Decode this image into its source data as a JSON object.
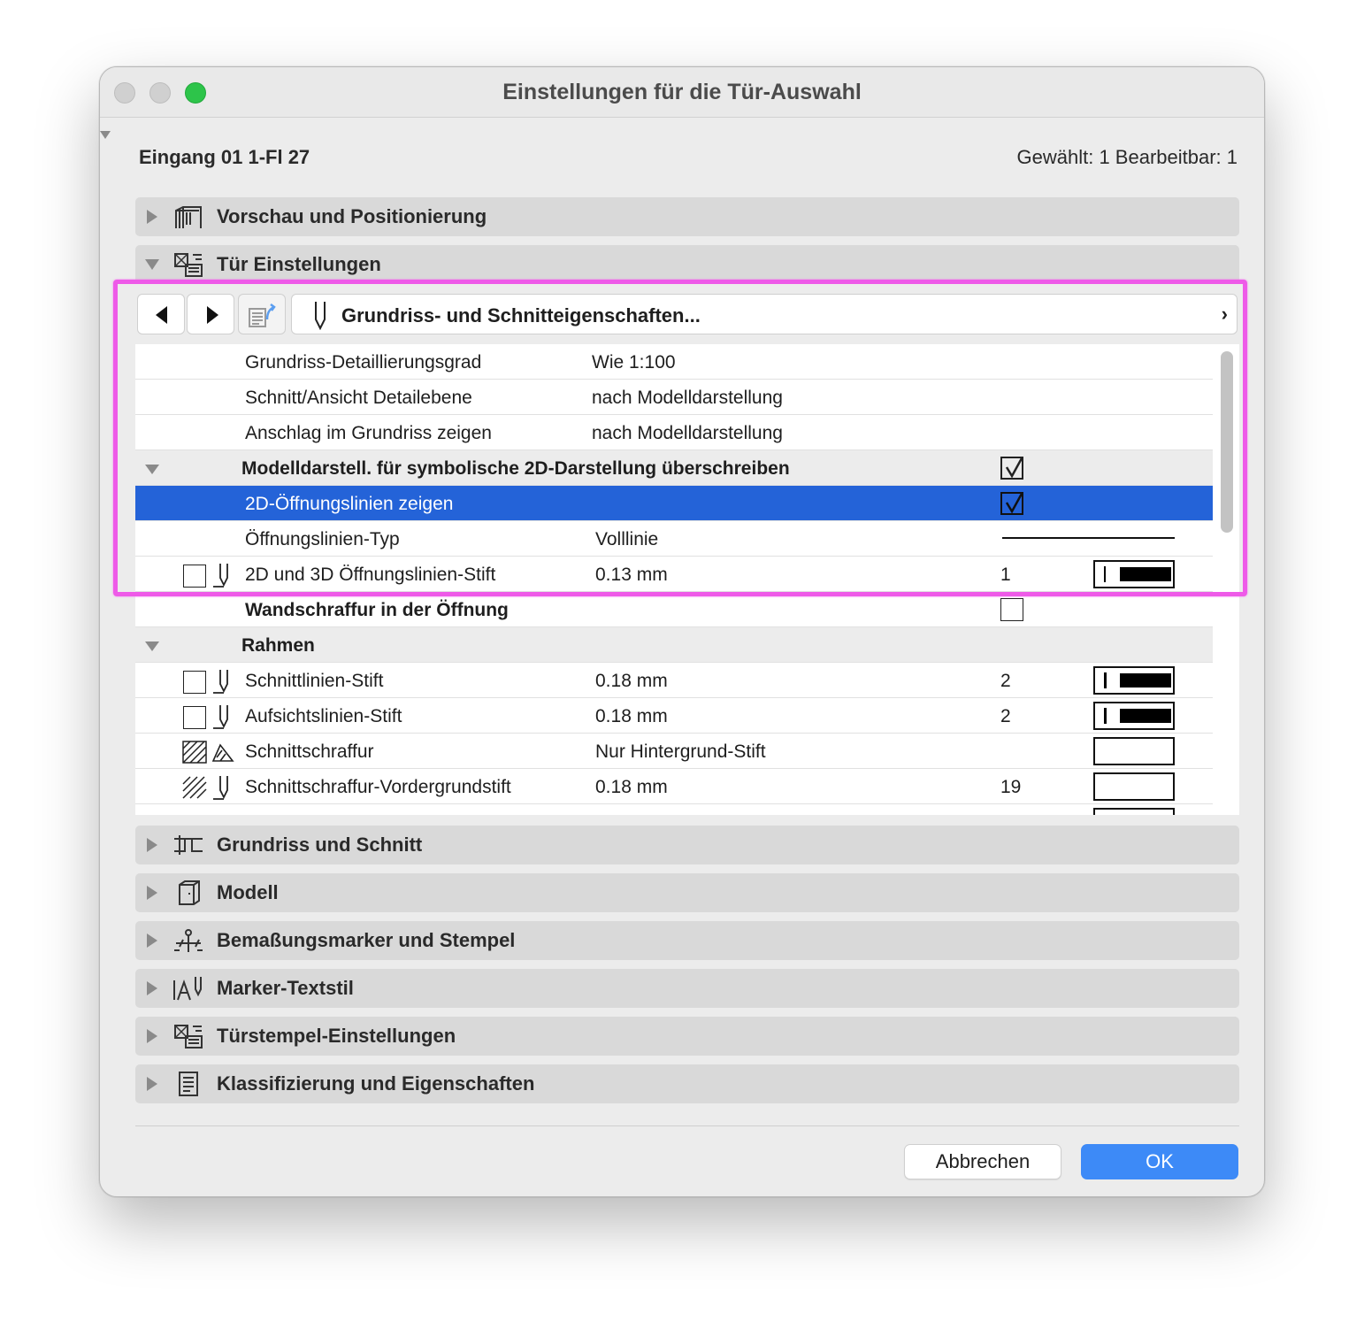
{
  "window": {
    "title": "Einstellungen für die Tür-Auswahl"
  },
  "header": {
    "element_name": "Eingang 01 1-Fl 27",
    "selection_info": "Gewählt: 1 Bearbeitbar: 1"
  },
  "panels_top": [
    {
      "label": "Vorschau und Positionierung",
      "expanded": false,
      "icon": "preview-door-icon"
    },
    {
      "label": "Tür Einstellungen",
      "expanded": true,
      "icon": "door-settings-icon"
    }
  ],
  "toolbar": {
    "page_label": "Grundriss- und Schnitteigenschaften...",
    "page_chevron": "›"
  },
  "rows": [
    {
      "label": "Grundriss-Detaillierungsgrad",
      "value": "Wie 1:100"
    },
    {
      "label": "Schnitt/Ansicht Detailebene",
      "value": "nach Modelldarstellung"
    },
    {
      "label": "Anschlag im Grundriss zeigen",
      "value": "nach Modelldarstellung"
    },
    {
      "label": "Modelldarstell. für symbolische 2D-Darstellung überschreiben",
      "group": true,
      "checked": true
    },
    {
      "label": "2D-Öffnungslinien zeigen",
      "selected": true,
      "checked": true
    },
    {
      "label": "Öffnungslinien-Typ",
      "value": "Volllinie"
    },
    {
      "label": "2D und 3D Öffnungslinien-Stift",
      "value": "0.13 mm",
      "num": "1"
    },
    {
      "label": "Wandschraffur in der Öffnung",
      "checked": false
    },
    {
      "label": "Rahmen",
      "group": true
    },
    {
      "label": "Schnittlinien-Stift",
      "value": "0.18 mm",
      "num": "2"
    },
    {
      "label": "Aufsichtslinien-Stift",
      "value": "0.18 mm",
      "num": "2"
    },
    {
      "label": "Schnittschraffur",
      "value": "Nur Hintergrund-Stift"
    },
    {
      "label": "Schnittschraffur-Vordergrundstift",
      "value": "0.18 mm",
      "num": "19"
    }
  ],
  "panels_bottom": [
    {
      "label": "Grundriss und Schnitt",
      "icon": "floorplan-section-icon"
    },
    {
      "label": "Modell",
      "icon": "model-icon"
    },
    {
      "label": "Bemaßungsmarker und Stempel",
      "icon": "dimension-marker-icon"
    },
    {
      "label": "Marker-Textstil",
      "icon": "marker-text-style-icon"
    },
    {
      "label": "Türstempel-Einstellungen",
      "icon": "door-stamp-icon"
    },
    {
      "label": "Klassifizierung und Eigenschaften",
      "icon": "classification-icon"
    }
  ],
  "buttons": {
    "cancel": "Abbrechen",
    "ok": "OK"
  },
  "colors": {
    "selection": "#2463d8",
    "ok_button": "#3d8af7",
    "annotation": "#ee5ae8",
    "zoom_button": "#2dc44a"
  }
}
